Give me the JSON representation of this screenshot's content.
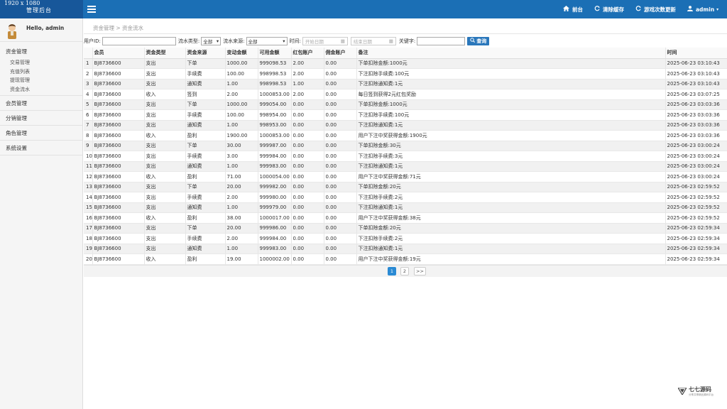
{
  "brand": {
    "resolution": "1920 x 1080",
    "title": "管理后台"
  },
  "topnav": {
    "home": "前台",
    "clear_cache": "清除缓存",
    "game_update": "游戏次数更新",
    "user": "admin"
  },
  "sidebar": {
    "greeting": "Hello, admin",
    "groups": {
      "funds": "资金管理",
      "members": "会员管理",
      "distribution": "分销管理",
      "roles": "角色管理",
      "settings": "系统设置"
    },
    "funds_items": [
      "交易管理",
      "充值列表",
      "提现管理",
      "资金流水"
    ]
  },
  "breadcrumb": "资金管理 > 资金流水",
  "filters": {
    "user_id_label": "用户ID:",
    "flow_type_label": "流水类型:",
    "flow_type_value": "全部",
    "flow_source_label": "流水来源:",
    "flow_source_value": "全部",
    "time_label": "时间:",
    "start_placeholder": "开始日期",
    "end_placeholder": "结束日期",
    "keyword_label": "关键字:",
    "search_label": "查询"
  },
  "table": {
    "headers": [
      "",
      "会员",
      "资金类型",
      "资金来源",
      "变动金额",
      "可用金额",
      "红包账户",
      "佣金账户",
      "备注",
      "时间"
    ],
    "rows": [
      [
        "1",
        "BJ8736600",
        "支出",
        "下单",
        "1000.00",
        "999098.53",
        "2.00",
        "0.00",
        "下单扣除金额:1000元",
        "2025-06-23 03:10:43"
      ],
      [
        "2",
        "BJ8736600",
        "支出",
        "手续费",
        "100.00",
        "998998.53",
        "2.00",
        "0.00",
        "下注扣除手续费:100元",
        "2025-06-23 03:10:43"
      ],
      [
        "3",
        "BJ8736600",
        "支出",
        "通知费",
        "1.00",
        "998998.53",
        "1.00",
        "0.00",
        "下注扣除通知费:1元",
        "2025-06-23 03:10:43"
      ],
      [
        "4",
        "BJ8736600",
        "收入",
        "签到",
        "2.00",
        "1000853.00",
        "2.00",
        "0.00",
        "每日签到获得2元红包奖励",
        "2025-06-23 03:07:25"
      ],
      [
        "5",
        "BJ8736600",
        "支出",
        "下单",
        "1000.00",
        "999054.00",
        "0.00",
        "0.00",
        "下单扣除金额:1000元",
        "2025-06-23 03:03:36"
      ],
      [
        "6",
        "BJ8736600",
        "支出",
        "手续费",
        "100.00",
        "998954.00",
        "0.00",
        "0.00",
        "下注扣除手续费:100元",
        "2025-06-23 03:03:36"
      ],
      [
        "7",
        "BJ8736600",
        "支出",
        "通知费",
        "1.00",
        "998953.00",
        "0.00",
        "0.00",
        "下注扣除通知费:1元",
        "2025-06-23 03:03:36"
      ],
      [
        "8",
        "BJ8736600",
        "收入",
        "盈利",
        "1900.00",
        "1000853.00",
        "0.00",
        "0.00",
        "用户下注中奖获得金额:1900元",
        "2025-06-23 03:03:36"
      ],
      [
        "9",
        "BJ8736600",
        "支出",
        "下单",
        "30.00",
        "999987.00",
        "0.00",
        "0.00",
        "下单扣除金额:30元",
        "2025-06-23 03:00:24"
      ],
      [
        "10",
        "BJ8736600",
        "支出",
        "手续费",
        "3.00",
        "999984.00",
        "0.00",
        "0.00",
        "下注扣除手续费:3元",
        "2025-06-23 03:00:24"
      ],
      [
        "11",
        "BJ8736600",
        "支出",
        "通知费",
        "1.00",
        "999983.00",
        "0.00",
        "0.00",
        "下注扣除通知费:1元",
        "2025-06-23 03:00:24"
      ],
      [
        "12",
        "BJ8736600",
        "收入",
        "盈利",
        "71.00",
        "1000054.00",
        "0.00",
        "0.00",
        "用户下注中奖获得金额:71元",
        "2025-06-23 03:00:24"
      ],
      [
        "13",
        "BJ8736600",
        "支出",
        "下单",
        "20.00",
        "999982.00",
        "0.00",
        "0.00",
        "下单扣除金额:20元",
        "2025-06-23 02:59:52"
      ],
      [
        "14",
        "BJ8736600",
        "支出",
        "手续费",
        "2.00",
        "999980.00",
        "0.00",
        "0.00",
        "下注扣除手续费:2元",
        "2025-06-23 02:59:52"
      ],
      [
        "15",
        "BJ8736600",
        "支出",
        "通知费",
        "1.00",
        "999979.00",
        "0.00",
        "0.00",
        "下注扣除通知费:1元",
        "2025-06-23 02:59:52"
      ],
      [
        "16",
        "BJ8736600",
        "收入",
        "盈利",
        "38.00",
        "1000017.00",
        "0.00",
        "0.00",
        "用户下注中奖获得金额:38元",
        "2025-06-23 02:59:52"
      ],
      [
        "17",
        "BJ8736600",
        "支出",
        "下单",
        "20.00",
        "999986.00",
        "0.00",
        "0.00",
        "下单扣除金额:20元",
        "2025-06-23 02:59:34"
      ],
      [
        "18",
        "BJ8736600",
        "支出",
        "手续费",
        "2.00",
        "999984.00",
        "0.00",
        "0.00",
        "下注扣除手续费:2元",
        "2025-06-23 02:59:34"
      ],
      [
        "19",
        "BJ8736600",
        "支出",
        "通知费",
        "1.00",
        "999983.00",
        "0.00",
        "0.00",
        "下注扣除通知费:1元",
        "2025-06-23 02:59:34"
      ],
      [
        "20",
        "BJ8736600",
        "收入",
        "盈利",
        "19.00",
        "1000002.00",
        "0.00",
        "0.00",
        "用户下注中奖获得金额:19元",
        "2025-06-23 02:59:34"
      ]
    ]
  },
  "pagination": {
    "pages": [
      "1",
      "2"
    ],
    "next": ">>",
    "current": "1"
  },
  "watermark": {
    "title": "七七源码",
    "subtitle": "分享共享精品源码平台"
  },
  "colors": {
    "topbar": "#1b6fb5",
    "brand": "#17579a",
    "accent": "#2a8ad4"
  },
  "icons": {
    "menu": "hamburger-icon",
    "home": "home-icon",
    "refresh": "refresh-icon",
    "user": "user-icon"
  }
}
